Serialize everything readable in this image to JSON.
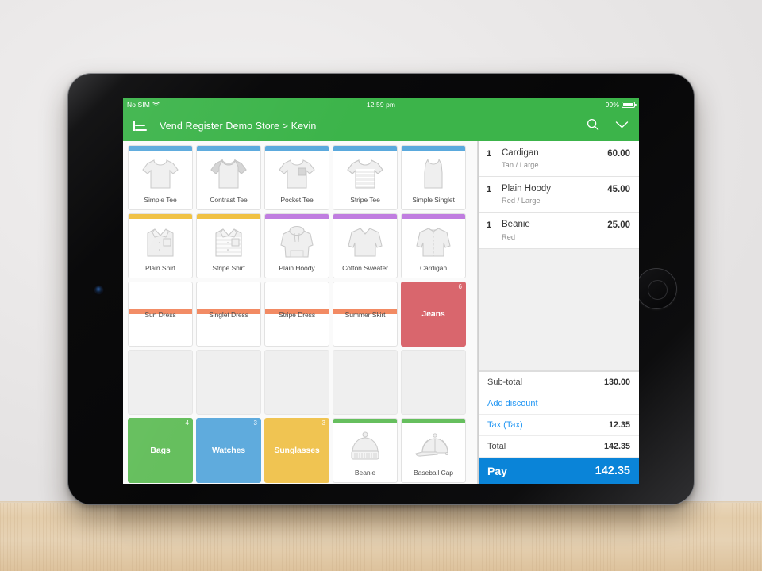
{
  "device": {
    "name": "tablet",
    "home_button": "home-button",
    "camera": "front-camera"
  },
  "status_bar": {
    "carrier": "No SIM",
    "wifi_icon": "wifi-icon",
    "time": "12:59 pm",
    "battery_percent": "99%",
    "battery_icon": "battery-full-icon"
  },
  "app_header": {
    "menu_icon": "hamburger-menu-icon",
    "title": "Vend Register Demo Store > Kevin",
    "search_icon": "search-icon",
    "chevron_icon": "chevron-down-icon"
  },
  "colors": {
    "brand_green": "#3cb44a",
    "pay_blue": "#0a84d8",
    "link_blue": "#2196f3",
    "accent_blue": "#5aa9dd",
    "accent_yellow": "#f0c040",
    "accent_purple": "#c07de0",
    "accent_orange": "#f28a63",
    "accent_green": "#66bf5e",
    "tile_red": "#d9666d",
    "tile_green": "#66bf5e",
    "tile_blue": "#5fabdd",
    "tile_yellow": "#f0c452"
  },
  "grid": {
    "rows": [
      [
        {
          "label": "Simple Tee",
          "accent": "#5aa9dd",
          "art": "tee",
          "kind": "product"
        },
        {
          "label": "Contrast Tee",
          "accent": "#5aa9dd",
          "art": "contrast",
          "kind": "product"
        },
        {
          "label": "Pocket Tee",
          "accent": "#5aa9dd",
          "art": "pocket",
          "kind": "product"
        },
        {
          "label": "Stripe Tee",
          "accent": "#5aa9dd",
          "art": "stripe",
          "kind": "product"
        },
        {
          "label": "Simple Singlet",
          "accent": "#5aa9dd",
          "art": "singlet",
          "kind": "product"
        }
      ],
      [
        {
          "label": "Plain Shirt",
          "accent": "#f0c040",
          "art": "shirt",
          "kind": "product"
        },
        {
          "label": "Stripe Shirt",
          "accent": "#f0c040",
          "art": "shirtstripe",
          "kind": "product"
        },
        {
          "label": "Plain Hoody",
          "accent": "#c07de0",
          "art": "hoody",
          "kind": "product"
        },
        {
          "label": "Cotton Sweater",
          "accent": "#c07de0",
          "art": "sweater",
          "kind": "product"
        },
        {
          "label": "Cardigan",
          "accent": "#c07de0",
          "art": "cardigan",
          "kind": "product"
        }
      ],
      [
        {
          "label": "Sun Dress",
          "accent": "#f28a63",
          "art": "none",
          "kind": "product-noart"
        },
        {
          "label": "Singlet Dress",
          "accent": "#f28a63",
          "art": "none",
          "kind": "product-noart"
        },
        {
          "label": "Stripe Dress",
          "accent": "#f28a63",
          "art": "none",
          "kind": "product-noart"
        },
        {
          "label": "Summer Skirt",
          "accent": "#f28a63",
          "art": "none",
          "kind": "product-noart"
        },
        {
          "label": "Jeans",
          "fill": "#d9666d",
          "badge": "6",
          "kind": "category"
        }
      ],
      [
        {
          "label": "",
          "kind": "empty"
        },
        {
          "label": "",
          "kind": "empty"
        },
        {
          "label": "",
          "kind": "empty"
        },
        {
          "label": "",
          "kind": "empty"
        },
        {
          "label": "",
          "kind": "empty"
        }
      ],
      [
        {
          "label": "Bags",
          "fill": "#66bf5e",
          "badge": "4",
          "kind": "category"
        },
        {
          "label": "Watches",
          "fill": "#5fabdd",
          "badge": "3",
          "kind": "category"
        },
        {
          "label": "Sunglasses",
          "fill": "#f0c452",
          "badge": "3",
          "kind": "category"
        },
        {
          "label": "Beanie",
          "accent": "#66bf5e",
          "art": "beanie",
          "kind": "product"
        },
        {
          "label": "Baseball Cap",
          "accent": "#66bf5e",
          "art": "cap",
          "kind": "product"
        }
      ]
    ]
  },
  "cart": {
    "items": [
      {
        "qty": "1",
        "name": "Cardigan",
        "variant": "Tan / Large",
        "price": "60.00"
      },
      {
        "qty": "1",
        "name": "Plain Hoody",
        "variant": "Red / Large",
        "price": "45.00"
      },
      {
        "qty": "1",
        "name": "Beanie",
        "variant": "Red",
        "price": "25.00"
      }
    ],
    "totals": [
      {
        "label": "Sub-total",
        "value": "130.00",
        "link": false
      },
      {
        "label": "Add discount",
        "value": "",
        "link": true
      },
      {
        "label": "Tax (Tax)",
        "value": "12.35",
        "link": true
      },
      {
        "label": "Total",
        "value": "142.35",
        "link": false
      }
    ],
    "pay": {
      "label": "Pay",
      "amount": "142.35"
    }
  }
}
